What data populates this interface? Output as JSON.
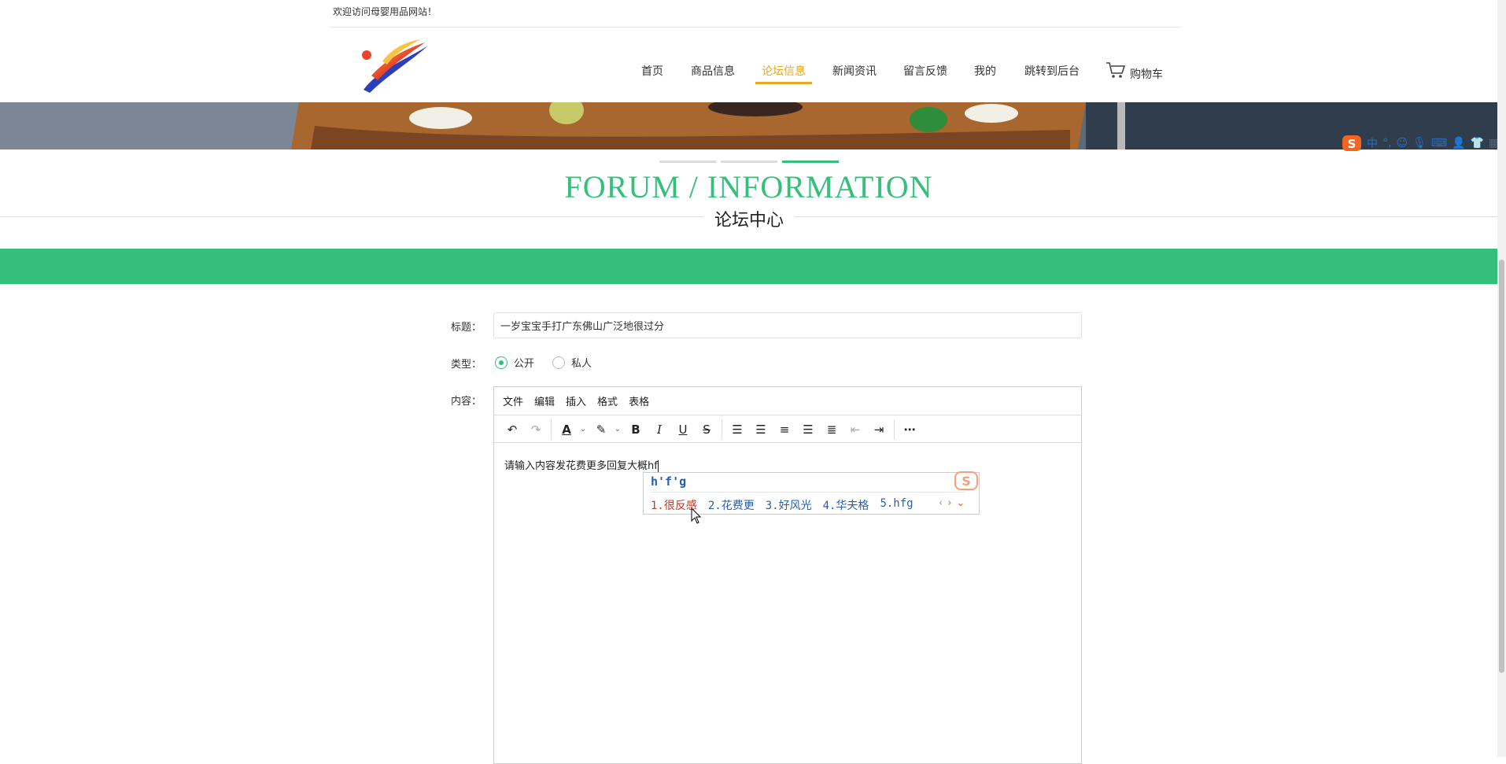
{
  "header": {
    "welcome": "欢迎访问母婴用品网站！",
    "nav": [
      {
        "label": "首页"
      },
      {
        "label": "商品信息"
      },
      {
        "label": "论坛信息"
      },
      {
        "label": "新闻资讯"
      },
      {
        "label": "留言反馈"
      },
      {
        "label": "我的"
      },
      {
        "label": "跳转到后台"
      }
    ],
    "active_nav": "论坛信息",
    "cart_label": "购物车"
  },
  "section": {
    "title_en": "FORUM / INFORMATION",
    "title_cn": "论坛中心"
  },
  "ime_tray": {
    "mode": "中",
    "punct": "°,"
  },
  "form": {
    "title_label": "标题：",
    "title_value": "一岁宝宝手打广东佛山广泛地很过分",
    "type_label": "类型：",
    "type_options": [
      {
        "label": "公开",
        "checked": true
      },
      {
        "label": "私人",
        "checked": false
      }
    ],
    "content_label": "内容："
  },
  "editor": {
    "menu": [
      "文件",
      "编辑",
      "插入",
      "格式",
      "表格"
    ],
    "text": "请输入内容发花费更多回复大概hf"
  },
  "ime_popup": {
    "input": "h'f'g",
    "candidates": [
      "1.很反感",
      "2.花费更",
      "3.好风光",
      "4.华夫格",
      "5.hfg"
    ]
  },
  "colors": {
    "accent": "#34c07c",
    "nav_active": "#e9a820"
  }
}
